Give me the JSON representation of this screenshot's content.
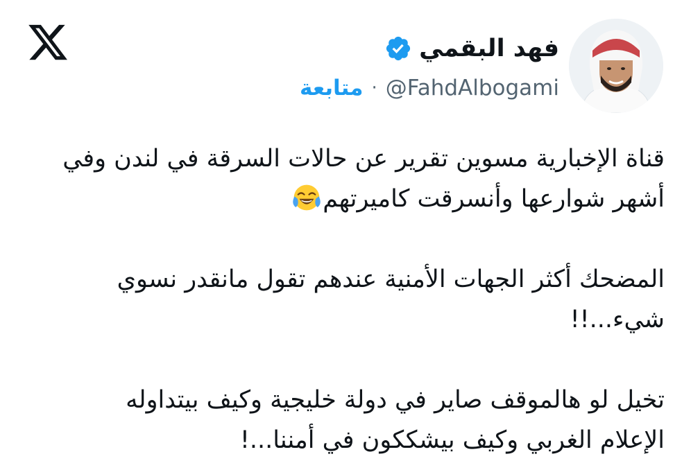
{
  "header": {
    "logo_icon": "x-logo-icon",
    "display_name": "فهد البقمي",
    "verified_icon": "verified-badge-icon",
    "handle": "@FahdAlbogami",
    "separator": "·",
    "follow_label": "متابعة"
  },
  "tweet": {
    "paragraphs": [
      {
        "line1": "قناة الإخبارية مسوين تقرير عن حالات السرقة في لندن وفي",
        "line2": "أشهر شوارعها وأنسرقت كاميرتهم",
        "emoji": "face-with-tears-of-joy-icon"
      },
      {
        "line1": "المضحك أكثر الجهات الأمنية عندهم تقول مانقدر نسوي",
        "line2": "شيء...!!"
      },
      {
        "line1": "تخيل لو هالموقف صاير في دولة خليجية وكيف بيتداوله",
        "line2": "الإعلام الغربي وكيف بيشككون في أمننا...!"
      }
    ]
  },
  "colors": {
    "text": "#0f1419",
    "secondary": "#536471",
    "accent": "#1d9bf0"
  }
}
